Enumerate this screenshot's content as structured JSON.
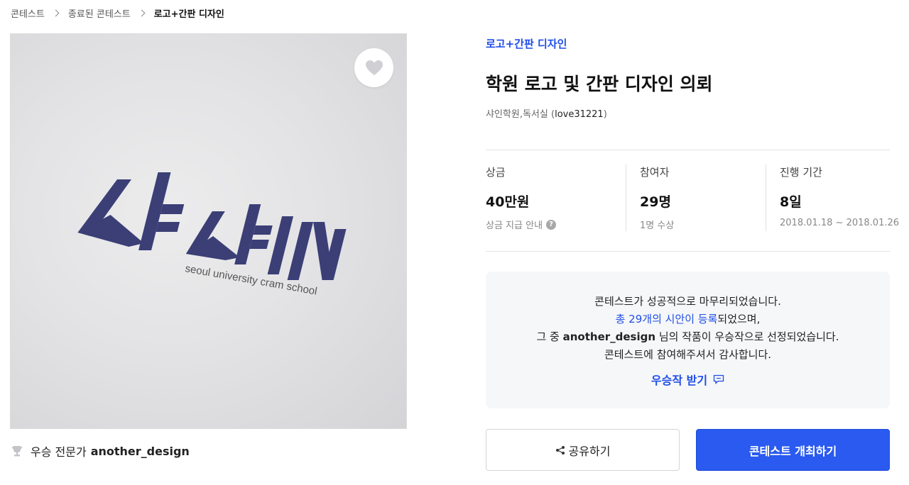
{
  "breadcrumb": [
    "콘테스트",
    "종료된 콘테스트",
    "로고+간판 디자인"
  ],
  "artwork": {
    "logo_text": "샤IN",
    "logo_tagline": "seoul university cram school",
    "brand_color": "#3b3f76",
    "like_icon": "heart-icon"
  },
  "winner": {
    "icon": "trophy-icon",
    "label": "우승 전문가",
    "name": "another_design"
  },
  "contest": {
    "category": "로고+간판 디자인",
    "title": "학원 로고 및 간판 디자인 의뢰",
    "host_name": "샤인학원,독서실",
    "host_id": "love31221"
  },
  "stats": {
    "prize": {
      "label": "상금",
      "value": "40만원",
      "sub": "상금 지급 안내",
      "help_icon": "?"
    },
    "participants": {
      "label": "참여자",
      "value": "29명",
      "sub": "1명 수상"
    },
    "duration": {
      "label": "진행 기간",
      "value": "8일",
      "sub": "2018.01.18 ~ 2018.01.26"
    }
  },
  "notice": {
    "line1": "콘테스트가 성공적으로 마무리되었습니다.",
    "line2_link": "총 29개의 시안이 등록",
    "line2_rest": "되었으며,",
    "line3_pre": "그 중 ",
    "line3_name": "another_design",
    "line3_post": " 님의 작품이 우승작으로 선정되었습니다.",
    "line4": "콘테스트에 참여해주셔서 감사합니다.",
    "receive_label": "우승작 받기",
    "receive_icon": "comment-icon"
  },
  "buttons": {
    "share": "공유하기",
    "share_icon": "share-icon",
    "host": "콘테스트 개최하기"
  },
  "colors": {
    "accent": "#1f4ee8",
    "primary_button": "#2a5af0",
    "notice_bg": "#f6f7f9"
  }
}
